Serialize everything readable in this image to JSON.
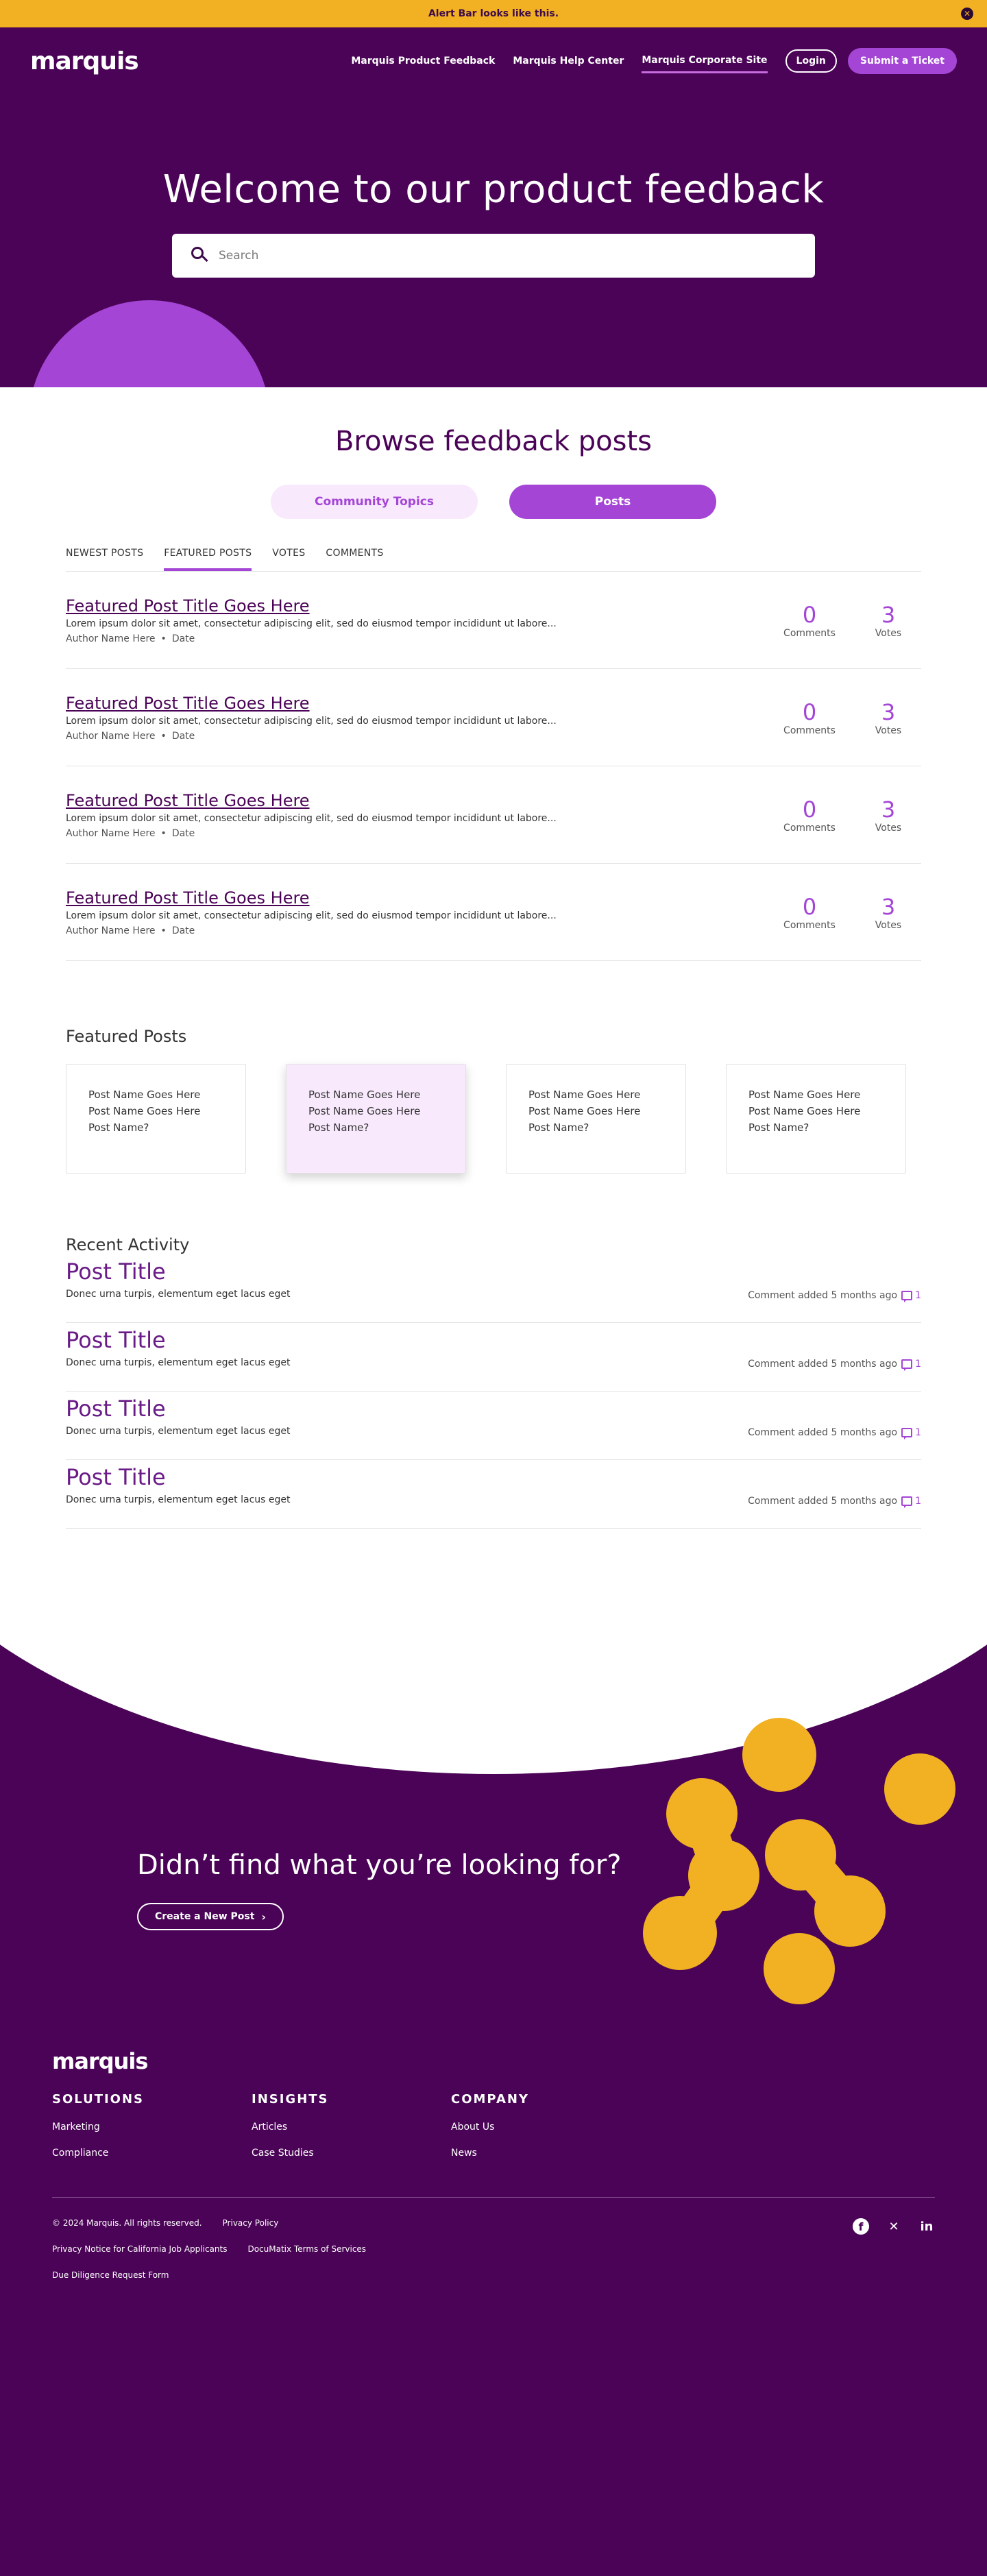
{
  "alert": {
    "text": "Alert Bar looks like this.",
    "close": "✕"
  },
  "brand": {
    "logo": "marquis",
    "purple": "#4a0356",
    "accent": "#a445d6",
    "yellow": "#f2b122"
  },
  "nav": {
    "links": [
      "Marquis Product Feedback",
      "Marquis Help Center",
      "Marquis Corporate Site"
    ],
    "active_index": 2,
    "login": "Login",
    "ticket": "Submit a Ticket"
  },
  "hero": {
    "title": "Welcome to our product feedback",
    "search_placeholder": "Search"
  },
  "browse": {
    "title": "Browse feedback posts",
    "toggles": [
      "Community Topics",
      "Posts"
    ],
    "tabs": [
      "NEWEST POSTS",
      "FEATURED POSTS",
      "VOTES",
      "COMMENTS"
    ],
    "active_tab": 1
  },
  "posts": [
    {
      "title": "Featured Post Title Goes Here",
      "excerpt": "Lorem ipsum dolor sit amet, consectetur adipiscing elit, sed do eiusmod tempor incididunt ut labore...",
      "author": "Author Name Here",
      "date": "Date",
      "comments": "0",
      "comments_label": "Comments",
      "votes": "3",
      "votes_label": "Votes"
    },
    {
      "title": "Featured Post Title Goes Here",
      "excerpt": "Lorem ipsum dolor sit amet, consectetur adipiscing elit, sed do eiusmod tempor incididunt ut labore...",
      "author": "Author Name Here",
      "date": "Date",
      "comments": "0",
      "comments_label": "Comments",
      "votes": "3",
      "votes_label": "Votes"
    },
    {
      "title": "Featured Post Title Goes Here",
      "excerpt": "Lorem ipsum dolor sit amet, consectetur adipiscing elit, sed do eiusmod tempor incididunt ut labore...",
      "author": "Author Name Here",
      "date": "Date",
      "comments": "0",
      "comments_label": "Comments",
      "votes": "3",
      "votes_label": "Votes"
    },
    {
      "title": "Featured Post Title Goes Here",
      "excerpt": "Lorem ipsum dolor sit amet, consectetur adipiscing elit, sed do eiusmod tempor incididunt ut labore...",
      "author": "Author Name Here",
      "date": "Date",
      "comments": "0",
      "comments_label": "Comments",
      "votes": "3",
      "votes_label": "Votes"
    }
  ],
  "featured": {
    "title": "Featured Posts",
    "cards": [
      "Post Name Goes Here Post Name Goes Here Post Name?",
      "Post Name Goes Here Post Name Goes Here Post Name?",
      "Post Name Goes Here Post Name Goes Here Post Name?",
      "Post Name Goes Here Post Name Goes Here Post Name?"
    ],
    "highlighted_index": 1
  },
  "recent": {
    "title": "Recent Activity",
    "items": [
      {
        "title": "Post Title",
        "sub": "Donec urna turpis, elementum eget lacus eget",
        "meta": "Comment added 5 months ago",
        "count": "1"
      },
      {
        "title": "Post Title",
        "sub": "Donec urna turpis, elementum eget lacus eget",
        "meta": "Comment added 5 months ago",
        "count": "1"
      },
      {
        "title": "Post Title",
        "sub": "Donec urna turpis, elementum eget lacus eget",
        "meta": "Comment added 5 months ago",
        "count": "1"
      },
      {
        "title": "Post Title",
        "sub": "Donec urna turpis, elementum eget lacus eget",
        "meta": "Comment added 5 months ago",
        "count": "1"
      }
    ]
  },
  "cta": {
    "title": "Didn’t find what you’re looking for?",
    "button": "Create a New Post"
  },
  "footer": {
    "logo": "marquis",
    "columns": [
      {
        "heading": "SOLUTIONS",
        "links": [
          "Marketing",
          "Compliance"
        ]
      },
      {
        "heading": "INSIGHTS",
        "links": [
          "Articles",
          "Case Studies"
        ]
      },
      {
        "heading": "COMPANY",
        "links": [
          "About Us",
          "News"
        ]
      }
    ],
    "copyright": "© 2024 Marquis. All rights reserved.",
    "privacy": "Privacy Policy",
    "privacy_ca": "Privacy Notice for California Job Applicants",
    "terms": "DocuMatix Terms of Services",
    "diligence": "Due Diligence Request Form",
    "social": [
      "facebook-icon",
      "x-icon",
      "linkedin-icon"
    ]
  }
}
